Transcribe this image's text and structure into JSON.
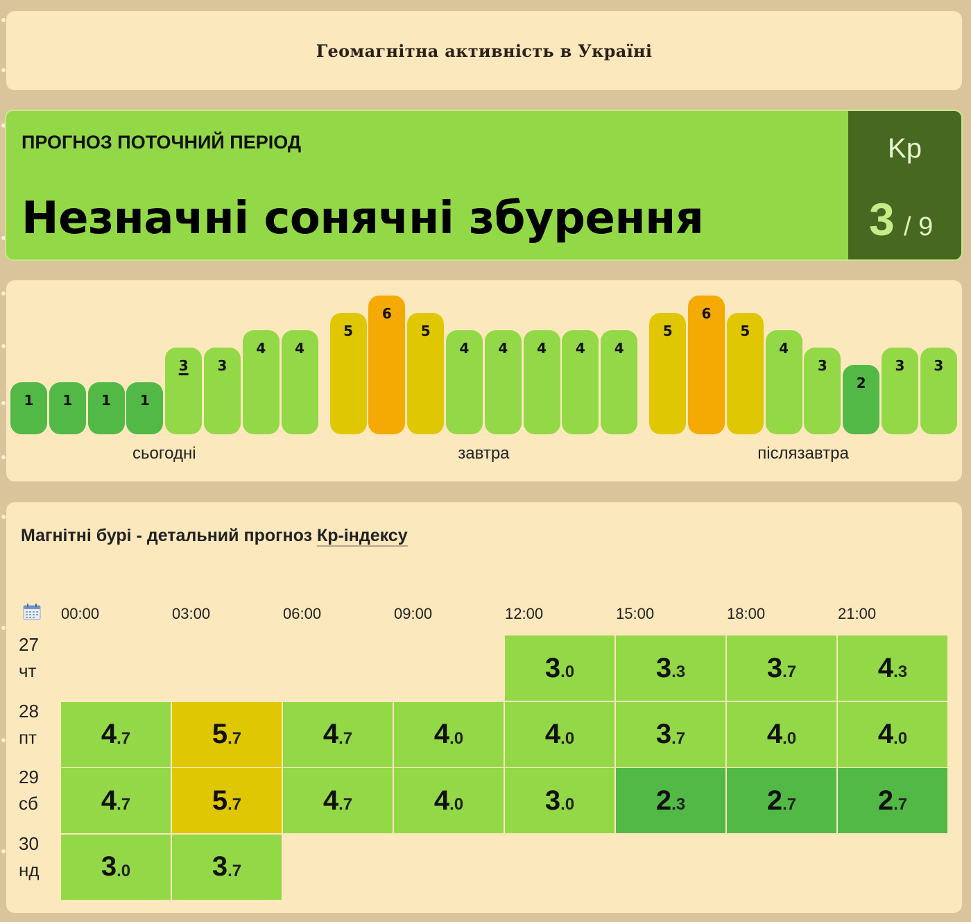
{
  "header": {
    "title": "Геомагнітна активність в Україні"
  },
  "current": {
    "period_label": "ПРОГНОЗ ПОТОЧНИЙ ПЕРІОД",
    "status": "Незначні сонячні збурення",
    "kp_label": "Kp",
    "kp_value": "3",
    "kp_max": "/ 9"
  },
  "colors": {
    "kp1": "#52b947",
    "kp2": "#52b947",
    "kp3": "#93d846",
    "kp4": "#93d846",
    "kp5": "#dfc704",
    "kp6": "#f5a903"
  },
  "bars": {
    "days": [
      {
        "label": "сьогодні",
        "values": [
          1,
          1,
          1,
          1,
          3,
          3,
          4,
          4
        ],
        "current_index": 4
      },
      {
        "label": "завтра",
        "values": [
          5,
          6,
          5,
          4,
          4,
          4,
          4,
          4
        ]
      },
      {
        "label": "післязавтра",
        "values": [
          5,
          6,
          5,
          4,
          3,
          2,
          3,
          3
        ]
      }
    ]
  },
  "detail": {
    "title_prefix": "Магнітні бурі - детальний прогноз ",
    "title_link": "Кр-індексу",
    "calendar_icon": "calendar-icon",
    "times": [
      "00:00",
      "03:00",
      "06:00",
      "09:00",
      "12:00",
      "15:00",
      "18:00",
      "21:00"
    ],
    "rows": [
      {
        "day": "27",
        "weekday": "чт",
        "values": [
          null,
          null,
          null,
          null,
          "3.0",
          "3.3",
          "3.7",
          "4.3"
        ]
      },
      {
        "day": "28",
        "weekday": "пт",
        "values": [
          "4.7",
          "5.7",
          "4.7",
          "4.0",
          "4.0",
          "3.7",
          "4.0",
          "4.0"
        ]
      },
      {
        "day": "29",
        "weekday": "сб",
        "values": [
          "4.7",
          "5.7",
          "4.7",
          "4.0",
          "3.0",
          "2.3",
          "2.7",
          "2.7"
        ]
      },
      {
        "day": "30",
        "weekday": "нд",
        "values": [
          "3.0",
          "3.7",
          null,
          null,
          null,
          null,
          null,
          null
        ]
      }
    ]
  }
}
